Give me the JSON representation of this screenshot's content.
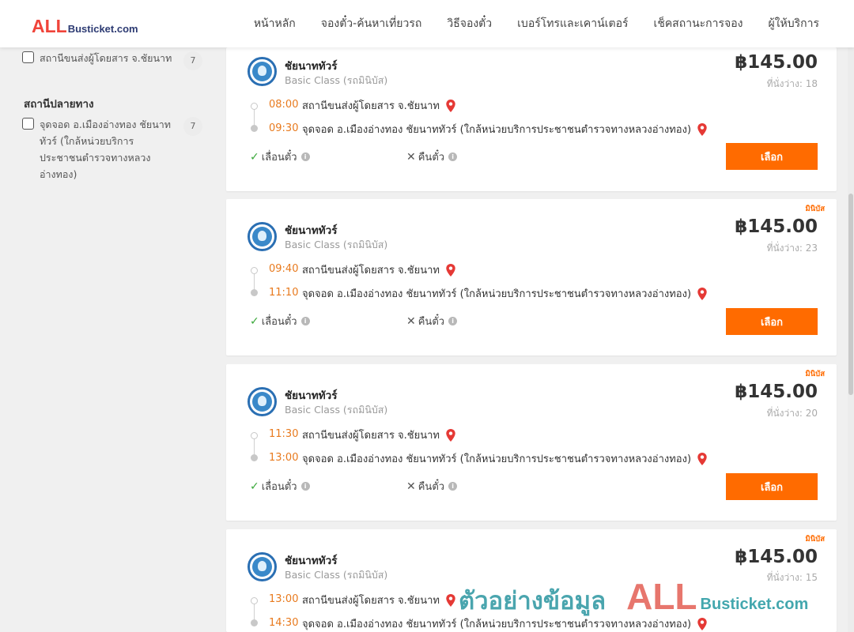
{
  "header": {
    "logo_all": "ALL",
    "logo_rest": "Busticket.com",
    "nav": [
      "หน้าหลัก",
      "จองตั๋ว-ค้นหาเที่ยวรถ",
      "วิธีจองตั๋ว",
      "เบอร์โทรและเคาน์เตอร์",
      "เช็คสถานะการจอง",
      "ผู้ให้บริการ"
    ]
  },
  "sidebar": {
    "origin_items": [
      {
        "label": "สถานีขนส่งผู้โดยสาร จ.ชัยนาท",
        "count": "7"
      }
    ],
    "destination_heading": "สถานีปลายทาง",
    "destination_items": [
      {
        "label": "จุดจอด อ.เมืองอ่างทอง ชัยนาททัวร์ (ใกล้หน่วยบริการประชาชนตำรวจทางหลวงอ่างทอง)",
        "count": "7"
      }
    ]
  },
  "trip_common": {
    "operator": "ชัยนาททัวร์",
    "class": "Basic Class (รถมินิบัส)",
    "origin": "สถานีขนส่งผู้โดยสาร จ.ชัยนาท",
    "destination": "จุดจอด อ.เมืองอ่างทอง ชัยนาททัวร์ (ใกล้หน่วยบริการประชาชนตำรวจทางหลวงอ่างทอง)",
    "reschedule": "เลื่อนตั๋ว",
    "refund": "คืนตั๋ว",
    "select": "เลือก",
    "minibus_tag": "มินิบัส"
  },
  "trips": [
    {
      "depart": "08:00",
      "arrive": "09:30",
      "price": "฿145.00",
      "seats": "ที่นั่งว่าง: 18"
    },
    {
      "depart": "09:40",
      "arrive": "11:10",
      "price": "฿145.00",
      "seats": "ที่นั่งว่าง: 23"
    },
    {
      "depart": "11:30",
      "arrive": "13:00",
      "price": "฿145.00",
      "seats": "ที่นั่งว่าง: 20"
    },
    {
      "depart": "13:00",
      "arrive": "14:30",
      "price": "฿145.00",
      "seats": "ที่นั่งว่าง: 15"
    }
  ],
  "watermark": {
    "sample": "ตัวอย่างข้อมูล",
    "all": "ALL",
    "rest": "Busticket.com"
  },
  "colors": {
    "accent": "#ff6b00",
    "time": "#e87a1e",
    "brand_red": "#f0443a",
    "brand_navy": "#2d3b73",
    "watermark_teal": "#3b9ea8"
  }
}
